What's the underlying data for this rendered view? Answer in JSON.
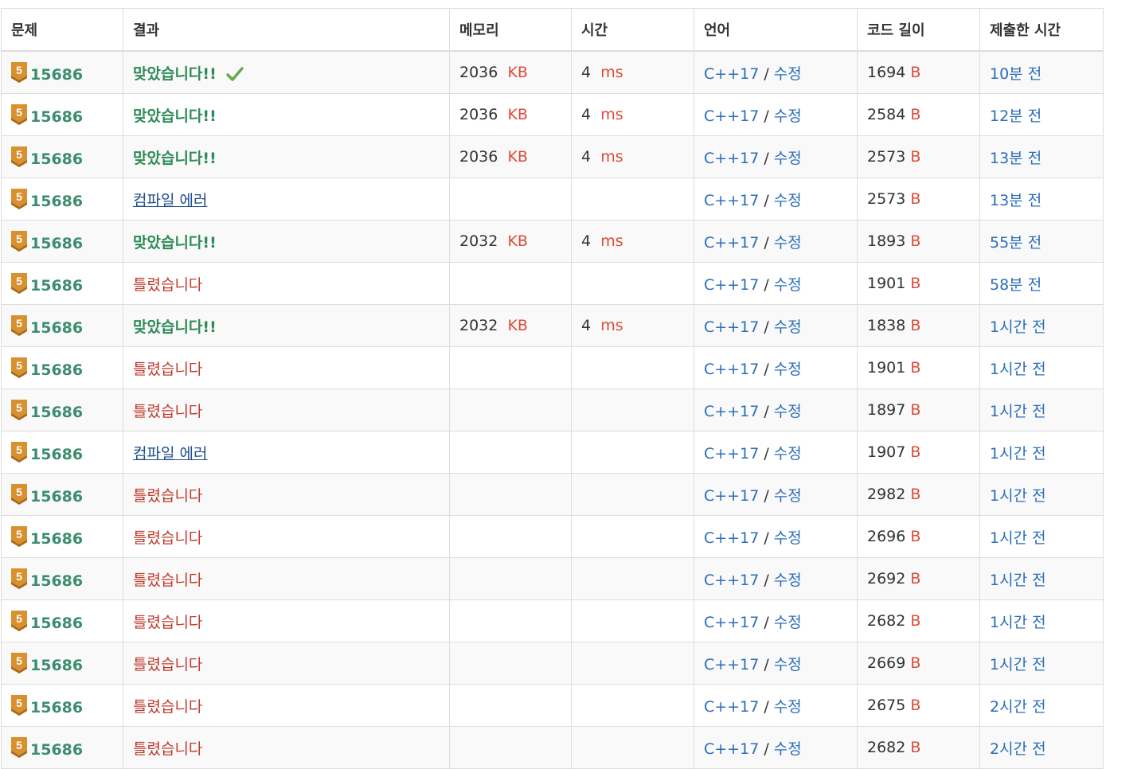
{
  "columns": [
    "문제",
    "결과",
    "메모리",
    "시간",
    "언어",
    "코드 길이",
    "제출한 시간"
  ],
  "units": {
    "memory": "KB",
    "time": "ms",
    "code": "B"
  },
  "lang_separator": " / ",
  "edit_label": "수정",
  "tier_badge_label": "5",
  "colors": {
    "accepted": "#2e8b57",
    "wrong": "#c0392b",
    "compile_error": "#1f4e8c",
    "link": "#2a6ebb",
    "unit": "#dd4b39",
    "tier_bronze": "#d9902f"
  },
  "rows": [
    {
      "problem": "15686",
      "result": "맞았습니다!!",
      "result_type": "ac",
      "check": true,
      "memory": "2036",
      "time": "4",
      "lang": "C++17",
      "code_length": "1694",
      "submitted": "10분 전"
    },
    {
      "problem": "15686",
      "result": "맞았습니다!!",
      "result_type": "ac",
      "check": false,
      "memory": "2036",
      "time": "4",
      "lang": "C++17",
      "code_length": "2584",
      "submitted": "12분 전"
    },
    {
      "problem": "15686",
      "result": "맞았습니다!!",
      "result_type": "ac",
      "check": false,
      "memory": "2036",
      "time": "4",
      "lang": "C++17",
      "code_length": "2573",
      "submitted": "13분 전"
    },
    {
      "problem": "15686",
      "result": "컴파일 에러",
      "result_type": "ce",
      "check": false,
      "memory": "",
      "time": "",
      "lang": "C++17",
      "code_length": "2573",
      "submitted": "13분 전"
    },
    {
      "problem": "15686",
      "result": "맞았습니다!!",
      "result_type": "ac",
      "check": false,
      "memory": "2032",
      "time": "4",
      "lang": "C++17",
      "code_length": "1893",
      "submitted": "55분 전"
    },
    {
      "problem": "15686",
      "result": "틀렸습니다",
      "result_type": "wa",
      "check": false,
      "memory": "",
      "time": "",
      "lang": "C++17",
      "code_length": "1901",
      "submitted": "58분 전"
    },
    {
      "problem": "15686",
      "result": "맞았습니다!!",
      "result_type": "ac",
      "check": false,
      "memory": "2032",
      "time": "4",
      "lang": "C++17",
      "code_length": "1838",
      "submitted": "1시간 전"
    },
    {
      "problem": "15686",
      "result": "틀렸습니다",
      "result_type": "wa",
      "check": false,
      "memory": "",
      "time": "",
      "lang": "C++17",
      "code_length": "1901",
      "submitted": "1시간 전"
    },
    {
      "problem": "15686",
      "result": "틀렸습니다",
      "result_type": "wa",
      "check": false,
      "memory": "",
      "time": "",
      "lang": "C++17",
      "code_length": "1897",
      "submitted": "1시간 전"
    },
    {
      "problem": "15686",
      "result": "컴파일 에러",
      "result_type": "ce",
      "check": false,
      "memory": "",
      "time": "",
      "lang": "C++17",
      "code_length": "1907",
      "submitted": "1시간 전"
    },
    {
      "problem": "15686",
      "result": "틀렸습니다",
      "result_type": "wa",
      "check": false,
      "memory": "",
      "time": "",
      "lang": "C++17",
      "code_length": "2982",
      "submitted": "1시간 전"
    },
    {
      "problem": "15686",
      "result": "틀렸습니다",
      "result_type": "wa",
      "check": false,
      "memory": "",
      "time": "",
      "lang": "C++17",
      "code_length": "2696",
      "submitted": "1시간 전"
    },
    {
      "problem": "15686",
      "result": "틀렸습니다",
      "result_type": "wa",
      "check": false,
      "memory": "",
      "time": "",
      "lang": "C++17",
      "code_length": "2692",
      "submitted": "1시간 전"
    },
    {
      "problem": "15686",
      "result": "틀렸습니다",
      "result_type": "wa",
      "check": false,
      "memory": "",
      "time": "",
      "lang": "C++17",
      "code_length": "2682",
      "submitted": "1시간 전"
    },
    {
      "problem": "15686",
      "result": "틀렸습니다",
      "result_type": "wa",
      "check": false,
      "memory": "",
      "time": "",
      "lang": "C++17",
      "code_length": "2669",
      "submitted": "1시간 전"
    },
    {
      "problem": "15686",
      "result": "틀렸습니다",
      "result_type": "wa",
      "check": false,
      "memory": "",
      "time": "",
      "lang": "C++17",
      "code_length": "2675",
      "submitted": "2시간 전"
    },
    {
      "problem": "15686",
      "result": "틀렸습니다",
      "result_type": "wa",
      "check": false,
      "memory": "",
      "time": "",
      "lang": "C++17",
      "code_length": "2682",
      "submitted": "2시간 전"
    }
  ]
}
